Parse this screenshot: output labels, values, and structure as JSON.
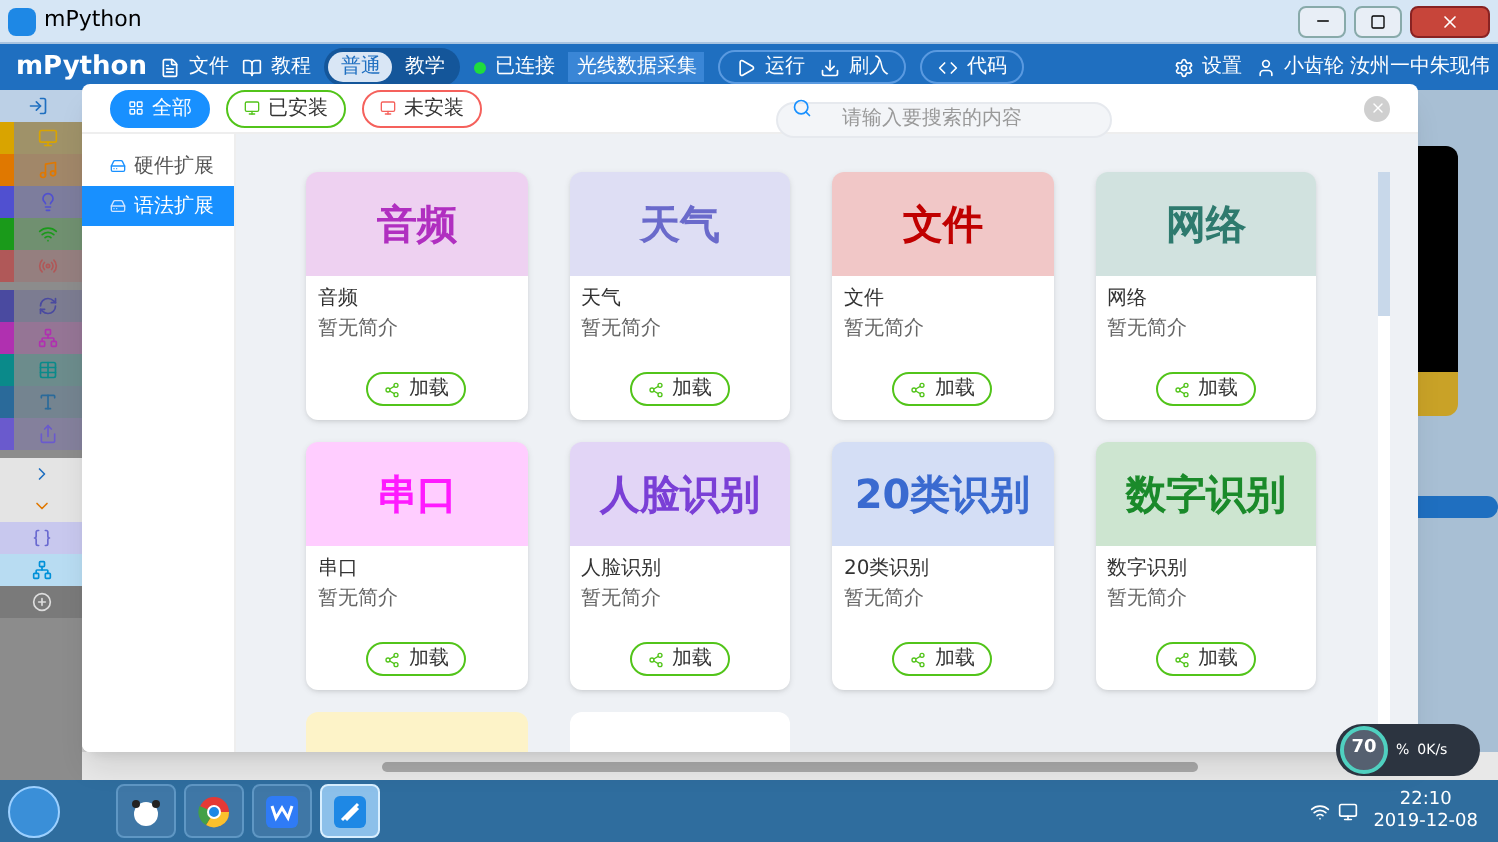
{
  "window": {
    "title": "mPython"
  },
  "toolbar": {
    "logo": "mPython",
    "menus": [
      {
        "label": "文件"
      },
      {
        "label": "教程"
      }
    ],
    "modes": [
      {
        "label": "普通",
        "selected": true
      },
      {
        "label": "教学",
        "selected": false
      }
    ],
    "connection": {
      "label": "已连接",
      "connected": true
    },
    "collect": "光线数据采集",
    "actions": [
      {
        "label": "运行"
      },
      {
        "label": "刷入"
      }
    ],
    "code": "代码",
    "settings": "设置",
    "user": "小齿轮 汝州一中朱现伟"
  },
  "palette": [
    {
      "color": "#d9a400"
    },
    {
      "color": "#e07800"
    },
    {
      "color": "#5050d0"
    },
    {
      "color": "#1a9a1a"
    },
    {
      "color": "#b05858"
    },
    {
      "color": "#4a4aa0"
    },
    {
      "color": "#b030b0"
    },
    {
      "color": "#0a8a8a"
    },
    {
      "color": "#2a6a9a"
    },
    {
      "color": "#6a5acd"
    }
  ],
  "dialog": {
    "filters": [
      {
        "label": "全部",
        "selected": true,
        "color": "#1890ff"
      },
      {
        "label": "已安装",
        "selected": false,
        "color": "#52c41a"
      },
      {
        "label": "未安装",
        "selected": false,
        "color": "#f5615c"
      }
    ],
    "search": {
      "placeholder": "请输入要搜索的内容"
    },
    "sidebar": [
      {
        "label": "硬件扩展",
        "selected": false
      },
      {
        "label": "语法扩展",
        "selected": true
      }
    ],
    "extensions": [
      {
        "title": "音频",
        "name": "音频",
        "description": "暂无简介",
        "button": "加载",
        "color": "#b02fc0"
      },
      {
        "title": "天气",
        "name": "天气",
        "description": "暂无简介",
        "button": "加载",
        "color": "#6a6acb"
      },
      {
        "title": "文件",
        "name": "文件",
        "description": "暂无简介",
        "button": "加载",
        "color": "#c00000"
      },
      {
        "title": "网络",
        "name": "网络",
        "description": "暂无简介",
        "button": "加载",
        "color": "#2e7a6e"
      },
      {
        "title": "串口",
        "name": "串口",
        "description": "暂无简介",
        "button": "加载",
        "color": "#ff1aff"
      },
      {
        "title": "人脸识别",
        "name": "人脸识别",
        "description": "暂无简介",
        "button": "加载",
        "color": "#7a3fd6"
      },
      {
        "title": "20类识别",
        "name": "20类识别",
        "description": "暂无简介",
        "button": "加载",
        "color": "#3a6ad0"
      },
      {
        "title": "数字识别",
        "name": "数字识别",
        "description": "暂无简介",
        "button": "加载",
        "color": "#1a8a2a"
      },
      {
        "color": "#fdf3c8"
      },
      {
        "color": "#ffffff"
      }
    ]
  },
  "speed_widget": {
    "percent": "70",
    "unit": "%",
    "upload": "0K/s"
  },
  "taskbar": {
    "apps": [
      {
        "selected": false
      },
      {
        "selected": false
      },
      {
        "selected": false
      },
      {
        "selected": true
      }
    ],
    "time": "22:10",
    "date": "2019-12-08"
  }
}
